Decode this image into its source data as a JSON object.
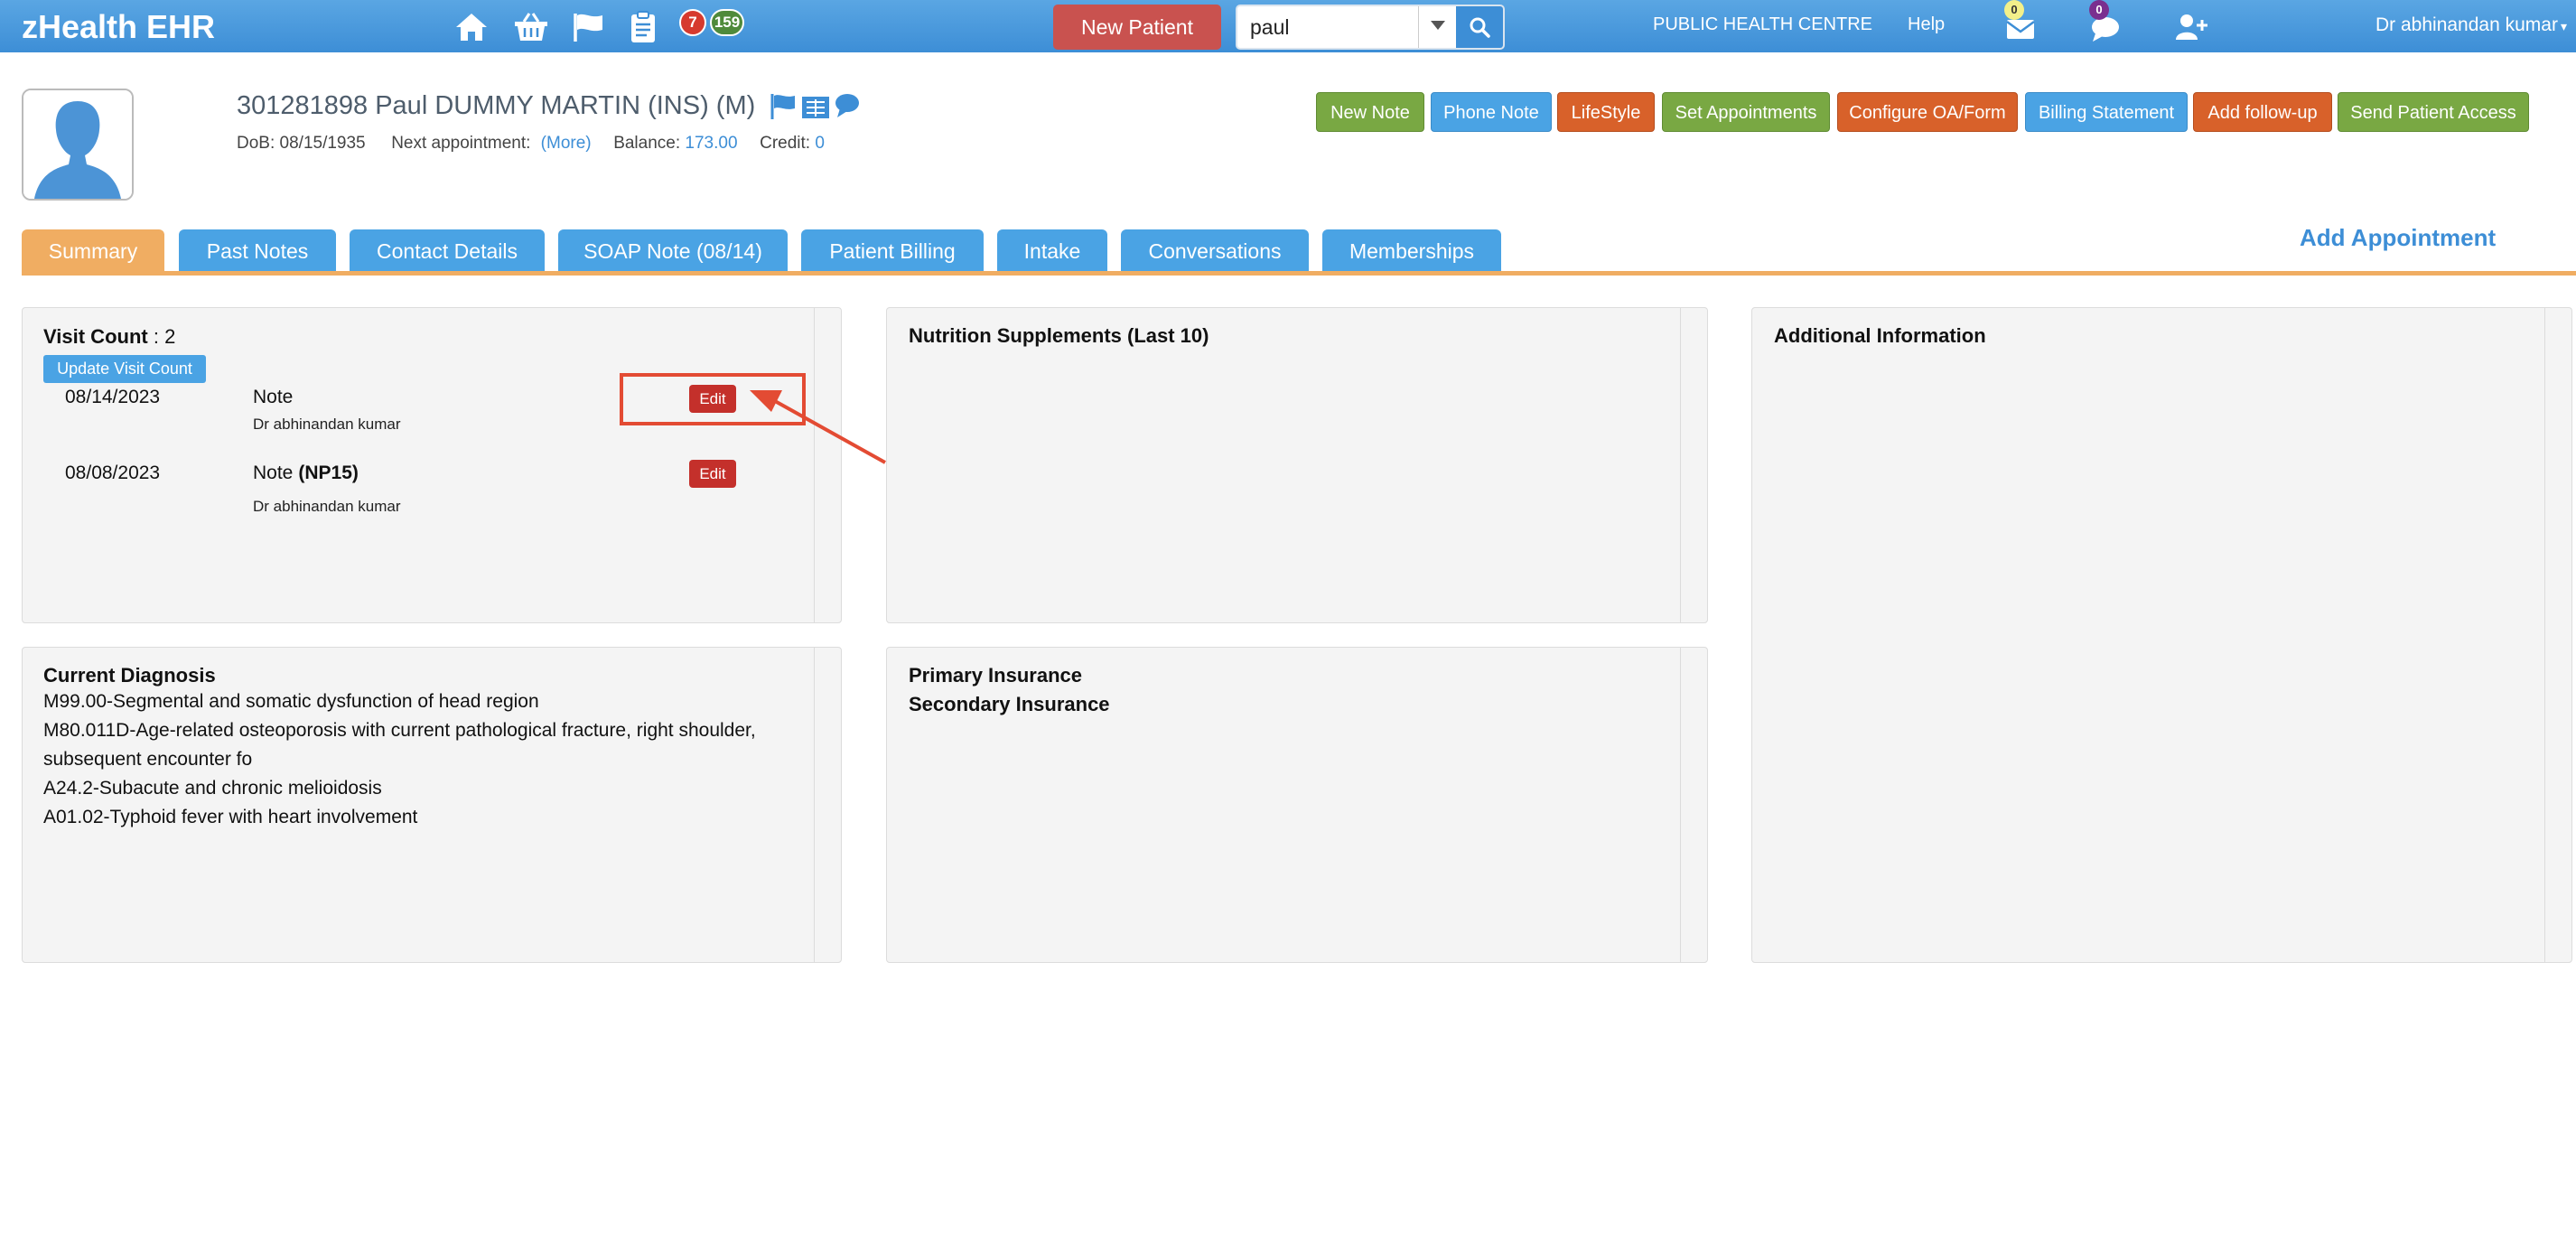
{
  "app": {
    "brand": "zHealth EHR"
  },
  "nav": {
    "badges": {
      "alerts": "7",
      "tasks": "159"
    },
    "new_patient_label": "New Patient",
    "search": {
      "value": "paul"
    },
    "centre": "PUBLIC HEALTH CENTRE",
    "help": "Help",
    "messages_count": "0",
    "chat_count": "0",
    "user": "Dr abhinandan kumar"
  },
  "patient": {
    "name": "301281898 Paul DUMMY MARTIN  (INS) (M)",
    "dob_label": "DoB:",
    "dob": "08/15/1935",
    "next_appt_label": "Next appointment:",
    "next_appt": "(More)",
    "balance_label": "Balance:",
    "balance": "173.00",
    "credit_label": "Credit:",
    "credit": "0"
  },
  "actions": [
    {
      "label": "New Note",
      "color": "#79a843"
    },
    {
      "label": "Phone Note",
      "color": "#4aa3e4"
    },
    {
      "label": "LifeStyle",
      "color": "#d8612a"
    },
    {
      "label": "Set Appointments",
      "color": "#79a843"
    },
    {
      "label": "Configure OA/Form",
      "color": "#d8612a"
    },
    {
      "label": "Billing Statement",
      "color": "#4aa3e4"
    },
    {
      "label": "Add follow-up",
      "color": "#d8612a"
    },
    {
      "label": "Send Patient Access",
      "color": "#79a843"
    }
  ],
  "tabs": [
    {
      "label": "Summary"
    },
    {
      "label": "Past Notes"
    },
    {
      "label": "Contact Details"
    },
    {
      "label": "SOAP Note (08/14)"
    },
    {
      "label": "Patient Billing"
    },
    {
      "label": "Intake"
    },
    {
      "label": "Conversations"
    },
    {
      "label": "Memberships"
    }
  ],
  "add_appointment": "Add Appointment",
  "visits": {
    "count_label": "Visit Count",
    "count_sep": " : ",
    "count": "2",
    "update_label": "Update Visit Count",
    "items": [
      {
        "date": "08/14/2023",
        "type": "Note",
        "code": "",
        "doctor": "Dr abhinandan kumar",
        "edit": "Edit"
      },
      {
        "date": "08/08/2023",
        "type": "Note",
        "code": "(NP15)",
        "doctor": "Dr abhinandan kumar",
        "edit": "Edit"
      }
    ]
  },
  "nutrition": {
    "title": "Nutrition Supplements (Last 10)"
  },
  "additional": {
    "title": "Additional Information"
  },
  "diagnosis": {
    "title": "Current Diagnosis",
    "items": [
      "M99.00-Segmental and somatic dysfunction of head region",
      "M80.011D-Age-related osteoporosis with current pathological fracture, right shoulder, subsequent encounter fo",
      "A24.2-Subacute and chronic melioidosis",
      "A01.02-Typhoid fever with heart involvement"
    ]
  },
  "insurance": {
    "primary": "Primary Insurance",
    "secondary": "Secondary Insurance"
  }
}
